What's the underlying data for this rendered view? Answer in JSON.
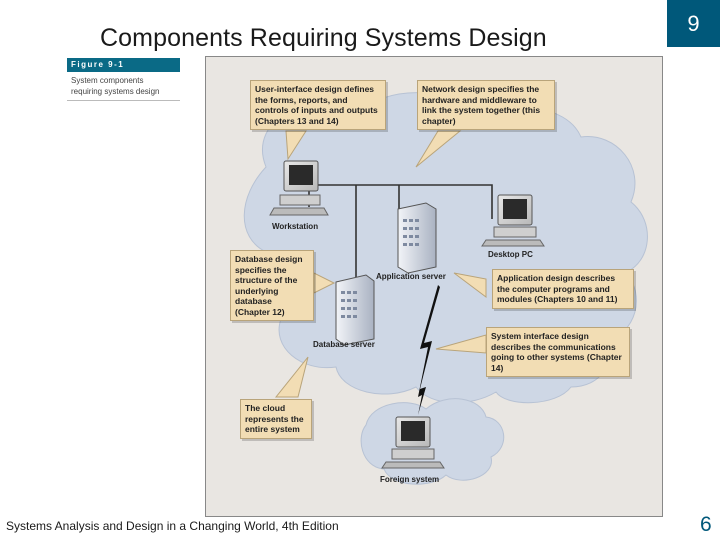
{
  "slide": {
    "title": "Components Requiring Systems Design",
    "chapter_badge": "9",
    "footer": "Systems Analysis and Design in a Changing World, 4th Edition",
    "page_number": "6"
  },
  "figure": {
    "number": "Figure 9-1",
    "caption_line1": "System components",
    "caption_line2": "requiring systems design"
  },
  "callouts": {
    "ui_design": "User-interface design defines the forms, reports, and controls of inputs and outputs (Chapters 13 and 14)",
    "network_design": "Network design specifies the hardware and middleware to link the system together (this chapter)",
    "database_design": "Database design specifies the structure of the underlying database (Chapter 12)",
    "application_design": "Application design describes the computer programs and modules (Chapters 10 and 11)",
    "system_interface_design": "System interface design describes the communications going to other systems (Chapter 14)",
    "cloud": "The cloud represents the entire system"
  },
  "nodes": {
    "workstation": "Workstation",
    "desktop_pc": "Desktop PC",
    "application_server": "Application server",
    "database_server": "Database server",
    "foreign_system": "Foreign system"
  },
  "colors": {
    "accent": "#00587a",
    "callout_fill": "#f2ddb4",
    "cloud_fill": "#ced7e5"
  }
}
